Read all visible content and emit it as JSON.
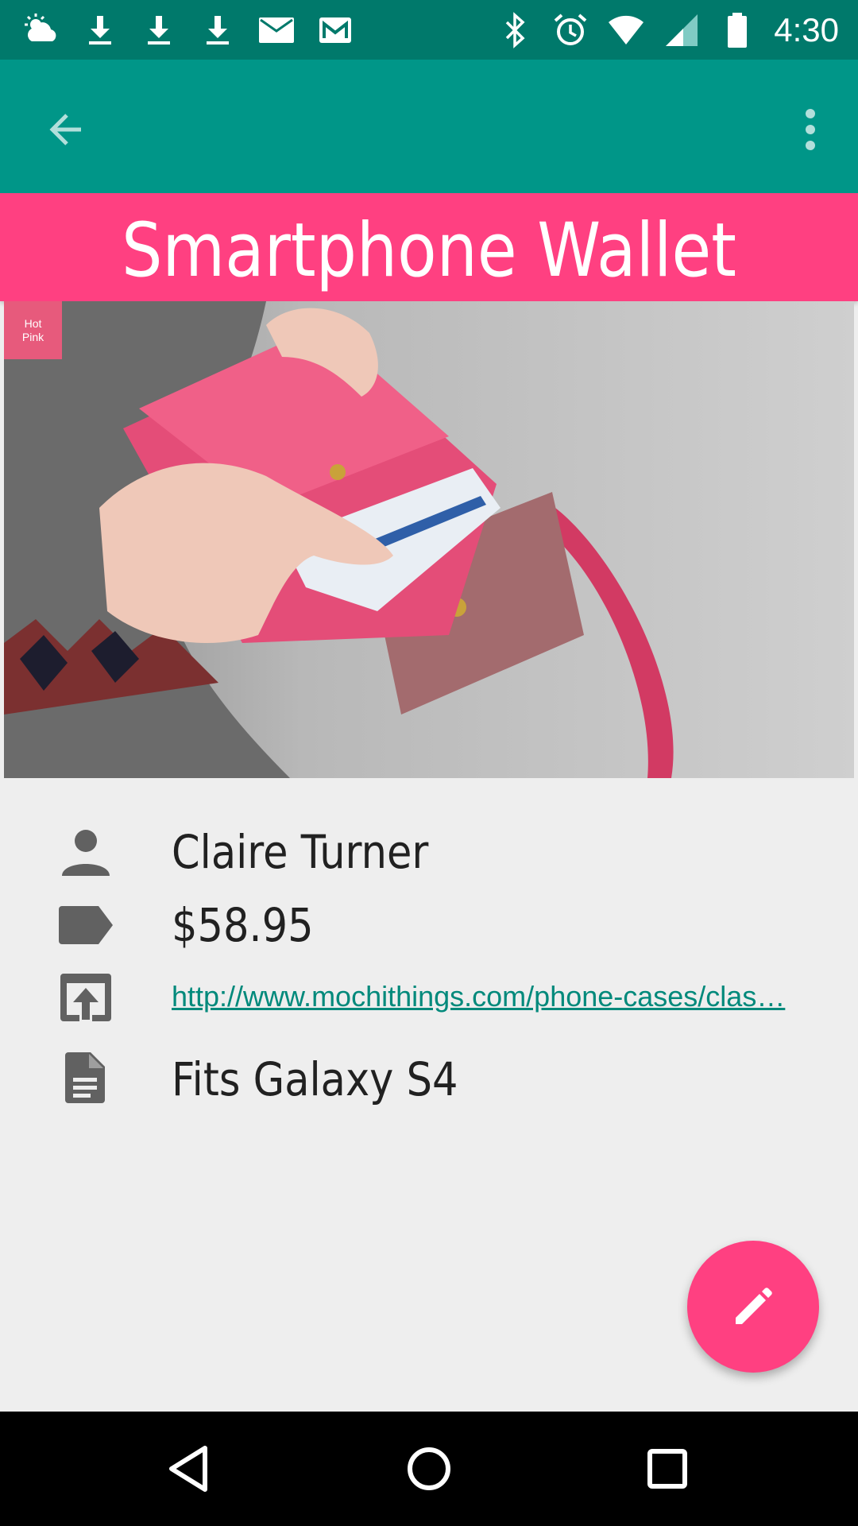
{
  "status_bar": {
    "time": "4:30",
    "left_icons": [
      "weather-cloudy-sun-icon",
      "download-icon",
      "download-icon",
      "download-icon",
      "mail-icon",
      "gmail-icon"
    ],
    "right_icons": [
      "bluetooth-icon",
      "alarm-icon",
      "wifi-icon",
      "cell-signal-icon",
      "battery-icon"
    ]
  },
  "toolbar": {
    "back_icon": "arrow-back-icon",
    "menu_icon": "more-vert-icon"
  },
  "item": {
    "title": "Smartphone Wallet",
    "color_chip_line1": "Hot",
    "color_chip_line2": "Pink",
    "photo": "pink-phone-wallet-photo",
    "owner": "Claire Turner",
    "price": "$58.95",
    "url": "http://www.mochithings.com/phone-cases/clas…",
    "notes": "Fits Galaxy S4"
  },
  "fab": {
    "icon": "edit-pencil-icon"
  },
  "nav_bar": {
    "icons": [
      "back-triangle-icon",
      "home-circle-icon",
      "recents-square-icon"
    ]
  },
  "colors": {
    "status_bar": "#00796b",
    "toolbar": "#009688",
    "accent": "#ff4081",
    "link": "#00897b",
    "background": "#eeeeee"
  }
}
